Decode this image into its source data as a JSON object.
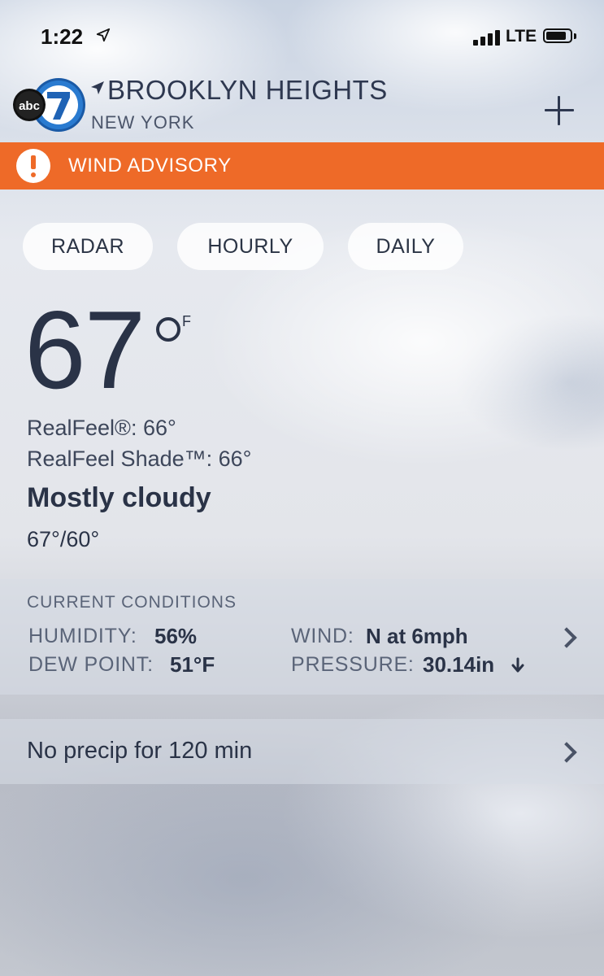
{
  "status_bar": {
    "time": "1:22",
    "network": "LTE",
    "location_icon": "location-arrow-icon",
    "signal_icon": "signal-bars-icon",
    "battery_icon": "battery-icon"
  },
  "header": {
    "logo_icon": "abc7-logo",
    "logo_text": "abc7",
    "city": "BROOKLYN HEIGHTS",
    "state": "NEW YORK",
    "add_icon": "plus-icon"
  },
  "alert": {
    "label": "WIND ADVISORY",
    "icon": "exclamation-icon",
    "color": "#ee6a28"
  },
  "tabs": [
    {
      "label": "RADAR"
    },
    {
      "label": "HOURLY"
    },
    {
      "label": "DAILY"
    }
  ],
  "current": {
    "temperature": "67",
    "unit": "F",
    "realfeel": "RealFeel®: 66°",
    "realfeel_shade": "RealFeel Shade™: 66°",
    "condition": "Mostly cloudy",
    "high_low": "67°/60°"
  },
  "conditions": {
    "title": "CURRENT CONDITIONS",
    "humidity_label": "HUMIDITY:",
    "humidity_value": "56%",
    "dew_point_label": "DEW POINT:",
    "dew_point_value": "51°F",
    "wind_label": "WIND:",
    "wind_value": "N at 6mph",
    "pressure_label": "PRESSURE:",
    "pressure_value": "30.14in",
    "pressure_trend_icon": "arrow-down-icon",
    "chevron_icon": "chevron-right-icon"
  },
  "precip": {
    "text": "No precip for 120 min",
    "chevron_icon": "chevron-right-icon"
  }
}
